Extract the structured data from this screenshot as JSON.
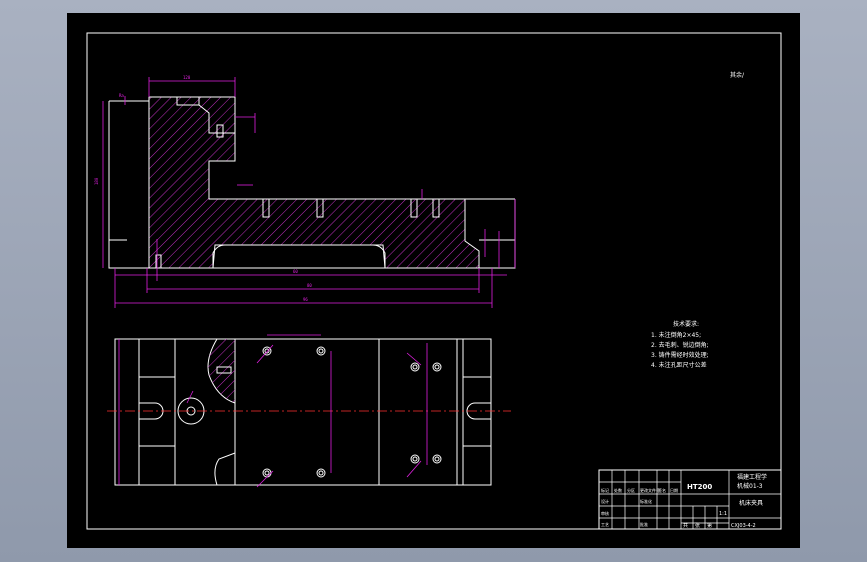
{
  "drawing": {
    "roughness_note": "其余/",
    "tech_requirements": {
      "title": "技术要求:",
      "items": [
        "1. 未注倒角2×45;",
        "2. 去毛刺、锐边倒角;",
        "3. 铸件需经时效处理;",
        "4. 未注孔距尺寸公差"
      ]
    },
    "title_block": {
      "material": "HT200",
      "company_line1": "福建工程学",
      "company_line2": "机械01-3",
      "part_name": "机床夹具",
      "drawing_no": "CXJ03-4-2",
      "scale_cell": "1:1",
      "sheet_cell_1": "共",
      "sheet_cell_2": "张",
      "sheet_cell_3": "第",
      "rev_labels": [
        "标记",
        "处数",
        "分区",
        "更改文件号",
        "签名",
        "日期"
      ],
      "role_labels": [
        "设计",
        "标准化",
        "审核",
        "工艺",
        "批准"
      ]
    },
    "colors": {
      "sheet": "#000000",
      "frame": "#ffffff",
      "part": "#ffffff",
      "dims": "#e020e0",
      "centerline": "#ff3030",
      "hatch": "#c030c0"
    }
  }
}
